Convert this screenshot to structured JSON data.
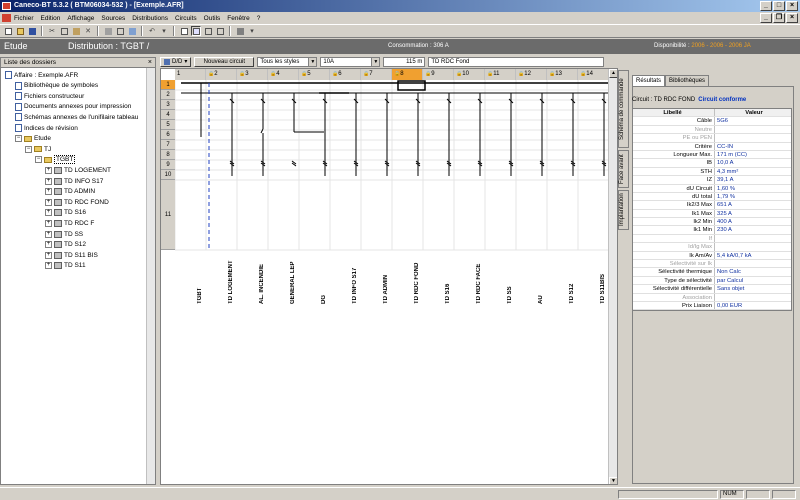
{
  "window": {
    "title": "Caneco-BT 5.3.2 ( BTM06034-532 ) - [Exemple.AFR]"
  },
  "menu": [
    "Fichier",
    "Edition",
    "Affichage",
    "Sources",
    "Distributions",
    "Circuits",
    "Outils",
    "Fenêtre",
    "?"
  ],
  "etude_bar": {
    "label": "Etude",
    "distribution": "Distribution : TGBT /",
    "consommation": "Consommation : 306 A",
    "disponibilite_label": "Disponibilité :",
    "disponibilite_value": "2006 - 2006 - 2006 JA"
  },
  "left_panel": {
    "title": "Liste des dossiers",
    "close": "×",
    "tree": [
      {
        "label": "Affaire : Exemple.AFR",
        "depth": 0,
        "icon": "affaire-icon"
      },
      {
        "label": "Bibliothèque de symboles",
        "depth": 1,
        "icon": "doc-icon"
      },
      {
        "label": "Fichiers constructeur",
        "depth": 1,
        "icon": "doc-icon"
      },
      {
        "label": "Documents annexes pour impression",
        "depth": 1,
        "icon": "doc-icon"
      },
      {
        "label": "Schémas annexes de l'unifilaire tableau",
        "depth": 1,
        "icon": "doc-icon"
      },
      {
        "label": "Indices de révision",
        "depth": 1,
        "icon": "doc-icon"
      },
      {
        "label": "Etude",
        "depth": 1,
        "icon": "folder-icon",
        "expander": "−"
      },
      {
        "label": "TJ",
        "depth": 2,
        "icon": "folder-icon",
        "expander": "−"
      },
      {
        "label": "TGBT",
        "depth": 3,
        "icon": "folder-icon",
        "expander": "−",
        "selected": true
      },
      {
        "label": "TD LOGEMENT",
        "depth": 4,
        "icon": "board-icon",
        "expander": "+"
      },
      {
        "label": "TD INFO S17",
        "depth": 4,
        "icon": "board-icon",
        "expander": "+"
      },
      {
        "label": "TD ADMIN",
        "depth": 4,
        "icon": "board-icon",
        "expander": "+"
      },
      {
        "label": "TD RDC FOND",
        "depth": 4,
        "icon": "board-icon",
        "expander": "+"
      },
      {
        "label": "TD S16",
        "depth": 4,
        "icon": "board-icon",
        "expander": "+"
      },
      {
        "label": "TD RDC F",
        "depth": 4,
        "icon": "board-icon",
        "expander": "+"
      },
      {
        "label": "TD SS",
        "depth": 4,
        "icon": "board-icon",
        "expander": "+"
      },
      {
        "label": "TD S12",
        "depth": 4,
        "icon": "board-icon",
        "expander": "+"
      },
      {
        "label": "TD S11 BIS",
        "depth": 4,
        "icon": "board-icon",
        "expander": "+"
      },
      {
        "label": "TD S11",
        "depth": 4,
        "icon": "board-icon",
        "expander": "+"
      }
    ]
  },
  "controls": {
    "view_mode": "D/D",
    "new_circuit": "Nouveau circuit",
    "styles": "Tous les styles",
    "rating": "10A",
    "length": "115 m",
    "circuit_name": "TD RDC Fond"
  },
  "grid": {
    "columns": [
      "1",
      "2",
      "3",
      "4",
      "5",
      "6",
      "7",
      "8",
      "9",
      "10",
      "11",
      "12",
      "13",
      "14",
      "15"
    ],
    "selected_column": "8",
    "rows": [
      "1",
      "2",
      "3",
      "4",
      "5",
      "6",
      "7",
      "8",
      "9",
      "10",
      "11"
    ],
    "selected_row": "1",
    "circuit_names": [
      "TGBT",
      "TD LOGEMENT",
      "AL. INCENDIE",
      "GENERAL LEP",
      "DG",
      "TD INFO S17",
      "TD ADMIN",
      "TD RDC FOND",
      "TD S16",
      "TD RDC FACE",
      "TD SS",
      "AU",
      "TD S12",
      "TD S11BIS"
    ]
  },
  "side_tabs": [
    "Schéma de commande",
    "Face avant",
    "Implantation"
  ],
  "right_panel": {
    "tabs": [
      "Résultats",
      "Bibliothèques"
    ],
    "circuit_label": "Circuit : TD RDC FOND",
    "circuit_status": "Circuit conforme",
    "columns": [
      "Libellé",
      "Valeur"
    ],
    "rows": [
      {
        "k": "Câble",
        "v": "5G6"
      },
      {
        "k": "Neutre",
        "v": "",
        "dim": true
      },
      {
        "k": "PE ou PEN",
        "v": "",
        "dim": true
      },
      {
        "k": "Critère",
        "v": "CC-IN"
      },
      {
        "k": "Longueur Max.",
        "v": "171 m (CC)"
      },
      {
        "k": "IB",
        "v": "10,0 A"
      },
      {
        "k": "STH",
        "v": "4,3 mm²"
      },
      {
        "k": "IZ",
        "v": "39,1 A"
      },
      {
        "k": "dU Circuit",
        "v": "1,60 %"
      },
      {
        "k": "dU total",
        "v": "1,79 %"
      },
      {
        "k": "Ik2/3 Max",
        "v": "651 A"
      },
      {
        "k": "Ik1 Max",
        "v": "325 A"
      },
      {
        "k": "Ik2 Min",
        "v": "400 A"
      },
      {
        "k": "Ik1 Min",
        "v": "230 A"
      },
      {
        "k": "If",
        "v": "",
        "dim": true
      },
      {
        "k": "Id/Ig Max",
        "v": "",
        "dim": true
      },
      {
        "k": "Ik Am/Av",
        "v": "5,4 kA/0,7 kA"
      },
      {
        "k": "Sélectivité sur Ik",
        "v": "",
        "dim": true
      },
      {
        "k": "Sélectivité thermique",
        "v": "Non Calc"
      },
      {
        "k": "Type de sélectivité",
        "v": "par Calcul"
      },
      {
        "k": "Sélectivité différentielle",
        "v": "Sans objet"
      },
      {
        "k": "Association",
        "v": "",
        "dim": true
      },
      {
        "k": "Prix Liaison",
        "v": "0,00 EUR"
      }
    ]
  },
  "status_bar": {
    "num": "NUM"
  }
}
